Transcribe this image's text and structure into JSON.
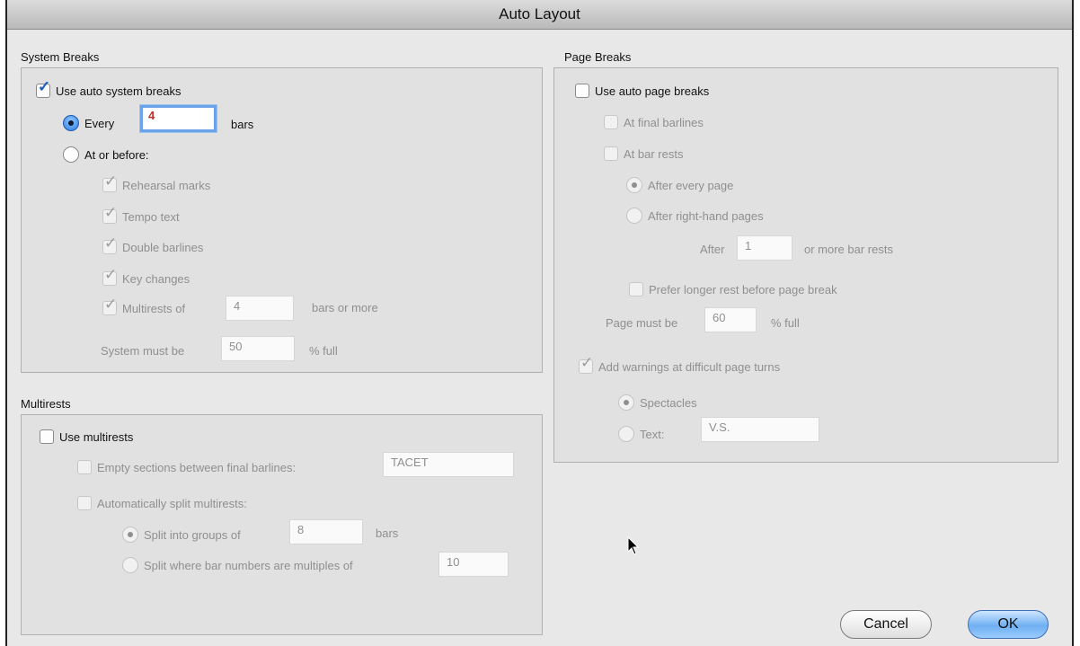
{
  "window": {
    "title": "Auto Layout"
  },
  "system_breaks": {
    "title": "System Breaks",
    "use_auto": {
      "label": "Use auto system breaks",
      "checked": true
    },
    "every": {
      "label": "Every",
      "value": "4",
      "suffix": "bars",
      "selected": true
    },
    "at_or_before": {
      "label": "At or before:",
      "selected": false
    },
    "options": [
      {
        "label": "Rehearsal marks",
        "checked": true
      },
      {
        "label": "Tempo text",
        "checked": true
      },
      {
        "label": "Double barlines",
        "checked": true
      },
      {
        "label": "Key changes",
        "checked": true
      }
    ],
    "multirests_of": {
      "label": "Multirests of",
      "value": "4",
      "suffix": "bars or more",
      "checked": true
    },
    "system_must_be": {
      "label": "System must be",
      "value": "50",
      "suffix": "% full"
    }
  },
  "multirests": {
    "title": "Multirests",
    "use": {
      "label": "Use multirests",
      "checked": false
    },
    "empty_sections": {
      "label": "Empty sections between final barlines:",
      "value": "TACET"
    },
    "auto_split": {
      "label": "Automatically split multirests:"
    },
    "split_groups": {
      "label": "Split into groups of",
      "value": "8",
      "suffix": "bars",
      "selected": true
    },
    "split_multiples": {
      "label": "Split where bar numbers are multiples of",
      "value": "10",
      "selected": false
    }
  },
  "page_breaks": {
    "title": "Page Breaks",
    "use_auto": {
      "label": "Use auto page breaks",
      "checked": false
    },
    "at_final_barlines": {
      "label": "At final barlines"
    },
    "at_bar_rests": {
      "label": "At bar rests"
    },
    "after_every_page": {
      "label": "After every page",
      "selected": true
    },
    "after_right_hand": {
      "label": "After right-hand pages",
      "selected": false
    },
    "after_rests": {
      "label": "After",
      "value": "1",
      "suffix": "or more bar rests"
    },
    "prefer_longer": {
      "label": "Prefer longer rest before page break"
    },
    "page_must_be": {
      "label": "Page must be",
      "value": "60",
      "suffix": "% full"
    },
    "add_warnings": {
      "label": "Add warnings at difficult page turns",
      "checked": true
    },
    "spectacles": {
      "label": "Spectacles",
      "selected": true
    },
    "text": {
      "label": "Text:",
      "value": "V.S.",
      "selected": false
    }
  },
  "buttons": {
    "cancel": "Cancel",
    "ok": "OK"
  },
  "colors": {
    "accent": "#2f7de0",
    "check": "#1d5fbe",
    "disabled_text": "#8f8f8f"
  }
}
